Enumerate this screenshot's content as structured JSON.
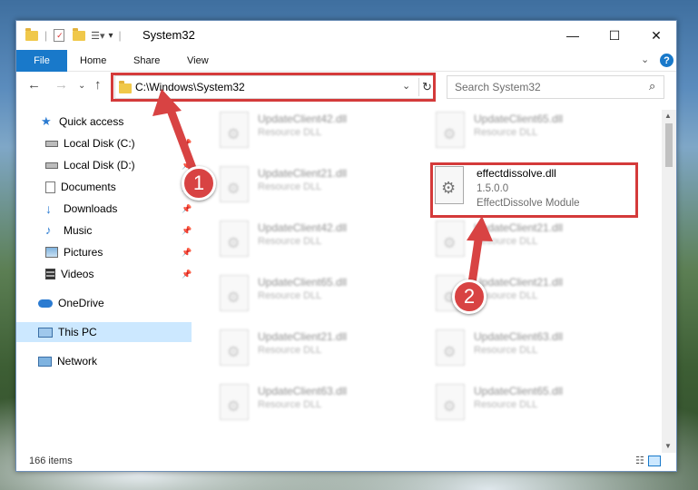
{
  "window": {
    "title": "System32"
  },
  "ribbon": {
    "tabs": [
      "File",
      "Home",
      "Share",
      "View"
    ],
    "help": "?"
  },
  "address": {
    "path": "C:\\Windows\\System32"
  },
  "search": {
    "placeholder": "Search System32"
  },
  "sidebar": {
    "items": [
      {
        "label": "Quick access",
        "icon": "star-icon",
        "pinned": false
      },
      {
        "label": "Local Disk (C:)",
        "icon": "drive-icon",
        "pinned": true
      },
      {
        "label": "Local Disk (D:)",
        "icon": "drive-icon",
        "pinned": true
      },
      {
        "label": "Documents",
        "icon": "documents-icon",
        "pinned": true
      },
      {
        "label": "Downloads",
        "icon": "download-icon",
        "pinned": true
      },
      {
        "label": "Music",
        "icon": "music-icon",
        "pinned": true
      },
      {
        "label": "Pictures",
        "icon": "pictures-icon",
        "pinned": true
      },
      {
        "label": "Videos",
        "icon": "videos-icon",
        "pinned": true
      },
      {
        "label": "OneDrive",
        "icon": "cloud-icon",
        "pinned": false
      },
      {
        "label": "This PC",
        "icon": "computer-icon",
        "pinned": false,
        "selected": true
      },
      {
        "label": "Network",
        "icon": "network-icon",
        "pinned": false
      }
    ]
  },
  "files": {
    "left_column": [
      {
        "name": "UpdateClient42.dll",
        "desc": "Resource DLL"
      },
      {
        "name": "UpdateClient21.dll",
        "desc": "Resource DLL"
      },
      {
        "name": "UpdateClient42.dll",
        "desc": "Resource DLL"
      },
      {
        "name": "UpdateClient65.dll",
        "desc": "Resource DLL"
      },
      {
        "name": "UpdateClient21.dll",
        "desc": "Resource DLL"
      },
      {
        "name": "UpdateClient63.dll",
        "desc": "Resource DLL"
      }
    ],
    "right_column": [
      {
        "name": "UpdateClient65.dll",
        "desc": "Resource DLL"
      },
      {
        "name": "UpdateClient21.dll",
        "desc": "Resource DLL"
      },
      {
        "name": "UpdateClient21.dll",
        "desc": "Resource DLL"
      },
      {
        "name": "UpdateClient63.dll",
        "desc": "Resource DLL"
      },
      {
        "name": "UpdateClient65.dll",
        "desc": "Resource DLL"
      }
    ],
    "highlighted": {
      "name": "effectdissolve.dll",
      "version": "1.5.0.0",
      "desc": "EffectDissolve Module"
    }
  },
  "status": {
    "item_count": "166 items"
  },
  "callouts": [
    "1",
    "2"
  ],
  "colors": {
    "accent": "#1979ca",
    "highlight": "#d43a3a",
    "selected": "#cce8ff"
  }
}
